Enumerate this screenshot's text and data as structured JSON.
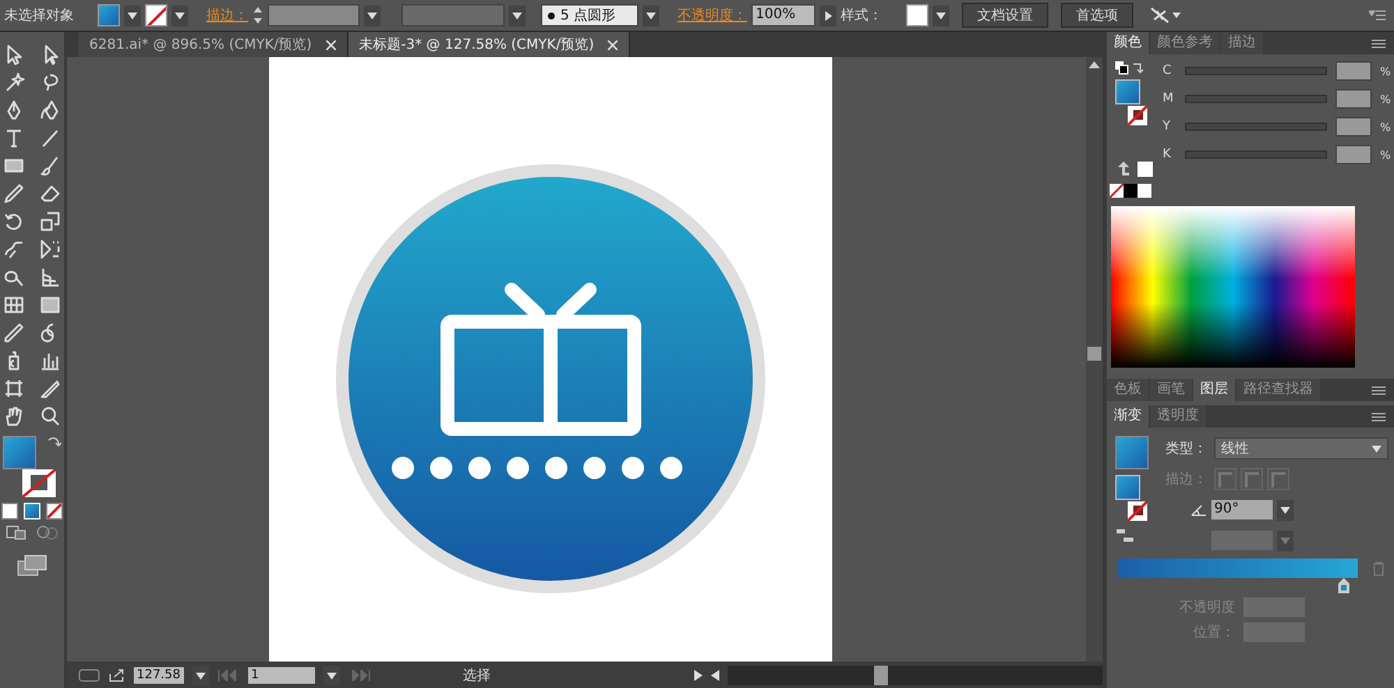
{
  "control_bar": {
    "selection_label": "未选择对象",
    "stroke_label": "描边：",
    "brush": "5 点圆形",
    "opacity_label": "不透明度：",
    "opacity": "100%",
    "style_label": "样式：",
    "buttons": [
      "文档设置",
      "首选项"
    ]
  },
  "document_tabs": [
    {
      "title": "6281.ai* @ 896.5% (CMYK/预览)",
      "selected": false
    },
    {
      "title": "未标题-3* @ 127.58% (CMYK/预览)",
      "selected": true
    }
  ],
  "color_panel": {
    "tabs": [
      {
        "label": "颜色",
        "selected": true
      },
      {
        "label": "颜色参考",
        "selected": false
      },
      {
        "label": "描边",
        "selected": false
      }
    ],
    "unit": "%",
    "channels": [
      {
        "name": "C",
        "level": 0
      },
      {
        "name": "M",
        "level": 0
      },
      {
        "name": "Y",
        "level": 0
      },
      {
        "name": "K",
        "level": 0
      }
    ]
  },
  "panel_group": {
    "tabs": [
      {
        "label": "色板",
        "selected": false
      },
      {
        "label": "画笔",
        "selected": false
      },
      {
        "label": "图层",
        "selected": true
      },
      {
        "label": "路径查找器",
        "selected": false
      }
    ]
  },
  "gradient_panel": {
    "tabs": [
      {
        "label": "渐变",
        "selected": true
      },
      {
        "label": "透明度",
        "selected": false
      }
    ],
    "type_label": "类型：",
    "type": "线性",
    "stroke_label": "描边：",
    "angle": "90°",
    "stop": {
      "level": 1
    },
    "opacity_label": "不透明度",
    "location_label": "位置："
  },
  "status_bar": {
    "zoom": "127.58",
    "page": "1",
    "tool": "选择"
  }
}
